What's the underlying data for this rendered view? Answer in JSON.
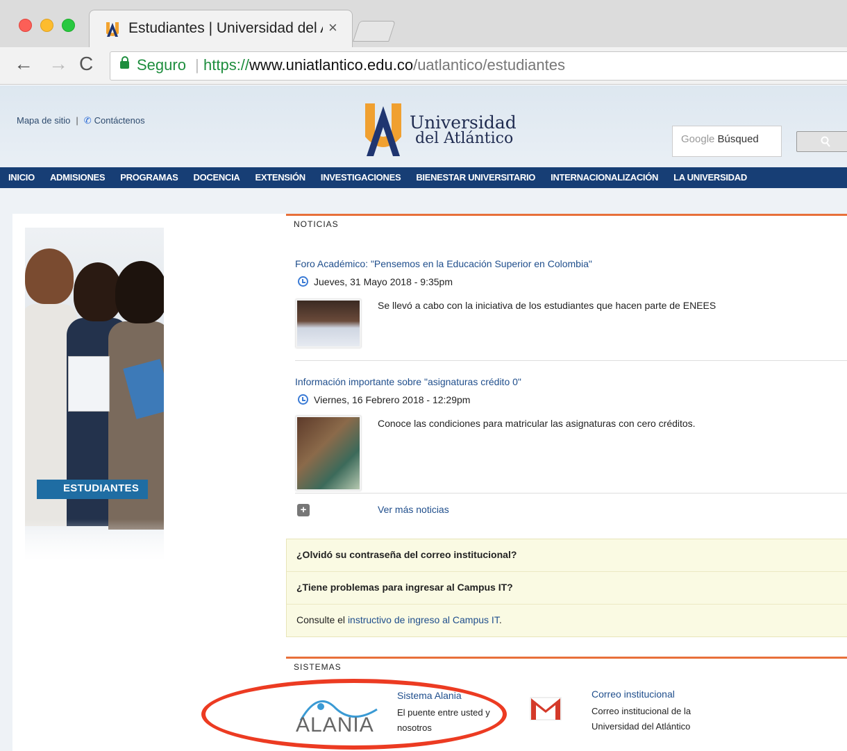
{
  "browser": {
    "tab_title": "Estudiantes | Universidad del A",
    "tab_close": "×",
    "secure_label": "Seguro",
    "separator": "|",
    "url_protocol": "https://",
    "url_host": "www.uniatlantico.edu.co",
    "url_path": "/uatlantico/estudiantes",
    "back": "←",
    "forward": "→",
    "reload": "C"
  },
  "header": {
    "sitemap": "Mapa de sitio",
    "pipe": "|",
    "contact": "Contáctenos",
    "logo_line1": "Universidad",
    "logo_line2": "del Atlántico",
    "search_google": "Google",
    "search_placeholder": "Búsqued",
    "search_button_icon": "magnifier-icon"
  },
  "nav": [
    "INICIO",
    "ADMISIONES",
    "PROGRAMAS",
    "DOCENCIA",
    "EXTENSIÓN",
    "INVESTIGACIONES",
    "BIENESTAR UNIVERSITARIO",
    "INTERNACIONALIZACIÓN",
    "LA UNIVERSIDAD"
  ],
  "sidebar": {
    "label": "ESTUDIANTES"
  },
  "news": {
    "heading": "NOTICIAS",
    "items": [
      {
        "title": "Foro Académico: \"Pensemos en la Educación Superior en Colombia\"",
        "date": "Jueves, 31 Mayo 2018 - 9:35pm",
        "summary": "Se llevó a cabo con la iniciativa de los estudiantes que hacen parte de ENEES"
      },
      {
        "title": "Información importante sobre \"asignaturas crédito 0\"",
        "date": "Viernes, 16 Febrero 2018 - 12:29pm",
        "summary": "Conoce las condiciones para matricular las asignaturas con cero créditos."
      }
    ],
    "more": "Ver más noticias"
  },
  "faq": {
    "q1": "¿Olvidó su contraseña del correo institucional?",
    "q2": "¿Tiene problemas para ingresar al Campus IT?",
    "consult_prefix": "Consulte el ",
    "consult_link": "instructivo de ingreso al Campus IT",
    "consult_suffix": "."
  },
  "systems": {
    "heading": "SISTEMAS",
    "alania_word": "ALANIA",
    "alania_title": "Sistema Alania",
    "alania_desc": "El puente entre usted y nosotros",
    "mail_title": "Correo institucional",
    "mail_desc": "Correo institucional de la Universidad del Atlántico"
  },
  "colors": {
    "nav": "#173e75",
    "accent": "#e8703a",
    "link": "#1f4e8c",
    "annotation": "#ec3b22"
  }
}
